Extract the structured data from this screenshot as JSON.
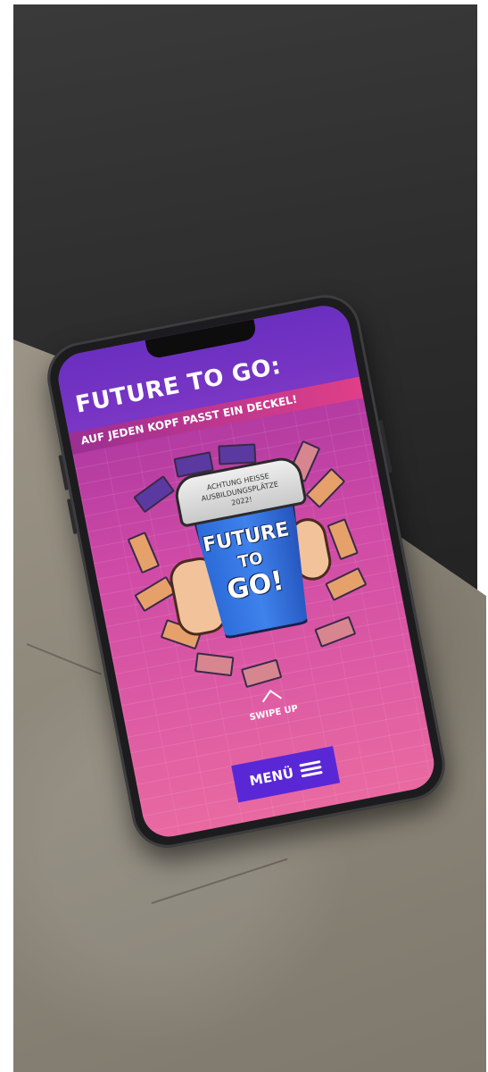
{
  "screen": {
    "title": "FUTURE TO GO:",
    "subtitle": "AUF JEDEN KOPF PASST EIN DECKEL!",
    "illustration": {
      "lid_line1": "ACHTUNG HEISSE",
      "lid_line2": "AUSBILDUNGSPLÄTZE",
      "lid_line3": "2022!",
      "cup_line1": "FUTURE",
      "cup_line2": "TO",
      "cup_line3": "GO!"
    },
    "swipe_label": "SWIPE UP",
    "menu_label": "MENÜ",
    "menu_icon": "hamburger-menu-icon"
  },
  "colors": {
    "header": "#6a2fc0",
    "background_pink": "#e96aa1",
    "menu_button": "#5a27d6",
    "cup_blue": "#3f82ec"
  }
}
